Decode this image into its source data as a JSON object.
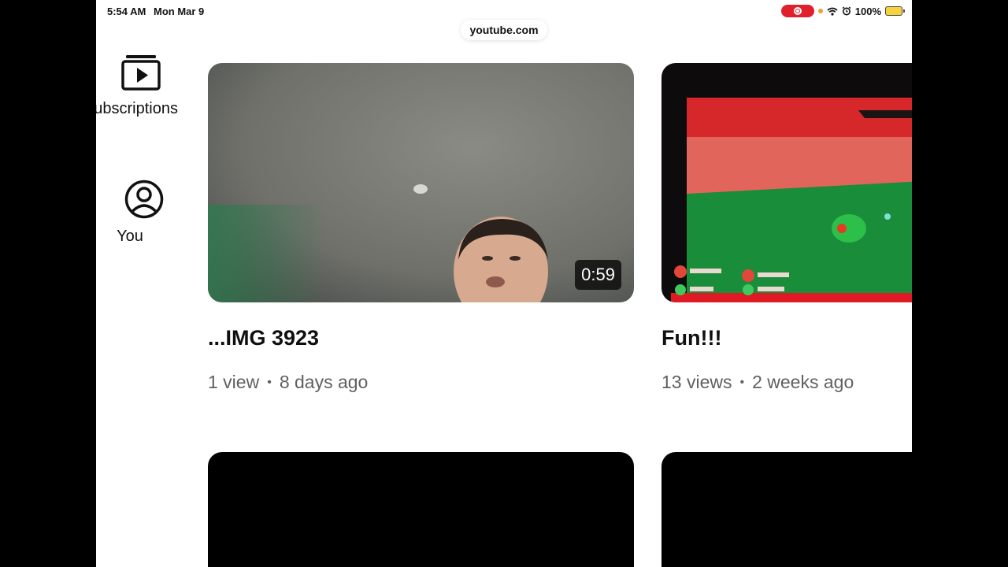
{
  "status_bar": {
    "time": "5:54 AM",
    "date": "Mon Mar 9",
    "battery": "100%",
    "icons": [
      "screen-record-icon",
      "wifi-icon",
      "alarm-icon",
      "battery-charging-icon"
    ]
  },
  "browser": {
    "url": "youtube.com"
  },
  "sidebar": {
    "items": [
      {
        "label": "Subscriptions",
        "icon": "subscriptions-icon"
      },
      {
        "label": "You",
        "icon": "account-circle-icon"
      }
    ]
  },
  "videos": [
    {
      "title": "...IMG 3923",
      "views": "1 view",
      "age": "8 days ago",
      "duration": "0:59"
    },
    {
      "title": "Fun!!!",
      "views": "13 views",
      "age": "2 weeks ago"
    }
  ],
  "colors": {
    "background": "#ffffff",
    "letterbox": "#000000",
    "record_red": "#e0202c"
  }
}
